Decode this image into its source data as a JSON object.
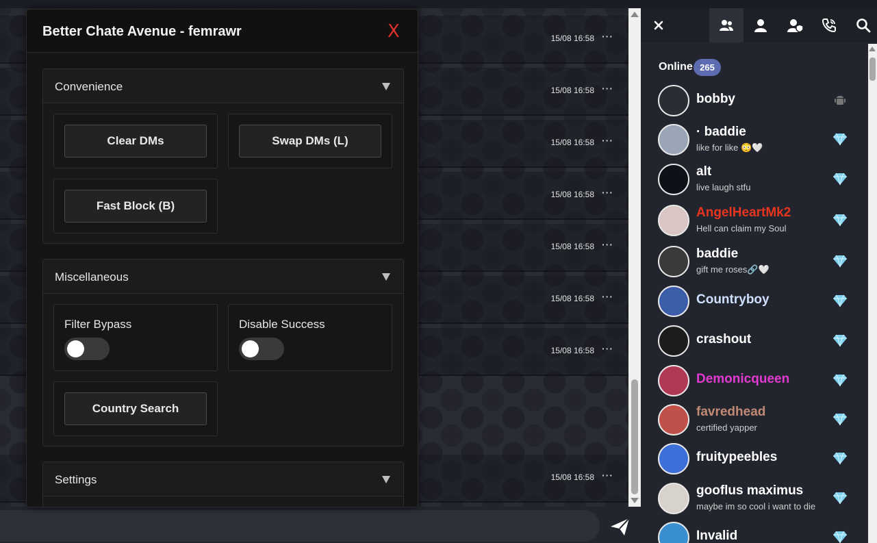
{
  "chat": {
    "messages": [
      {
        "time": "15/08 16:58",
        "more": "···"
      },
      {
        "time": "15/08 16:58",
        "more": "···"
      },
      {
        "time": "15/08 16:58",
        "more": "···"
      },
      {
        "time": "15/08 16:58",
        "more": "···"
      },
      {
        "time": "15/08 16:58",
        "more": "···"
      },
      {
        "time": "15/08 16:58",
        "more": "···"
      },
      {
        "time": "15/08 16:58",
        "more": "···"
      },
      {
        "time": "15/08 16:58",
        "more": "···"
      }
    ],
    "input_placeholder": ""
  },
  "panel": {
    "title": "Better Chate Avenue - femrawr",
    "close_label": "X",
    "sections": {
      "convenience": {
        "title": "Convenience",
        "clear_dms": "Clear DMs",
        "swap_dms": "Swap DMs (L)",
        "fast_block": "Fast Block (B)"
      },
      "misc": {
        "title": "Miscellaneous",
        "filter_bypass": "Filter Bypass",
        "filter_bypass_on": false,
        "disable_success": "Disable Success",
        "disable_success_on": false,
        "country_search": "Country Search"
      },
      "settings": {
        "title": "Settings"
      }
    }
  },
  "sidebar": {
    "close_icon": "close-icon",
    "tabs": [
      "users-icon",
      "user-icon",
      "user-shield-icon",
      "phone-icon",
      "search-icon"
    ],
    "online_label": "Online",
    "online_count": "265",
    "users": [
      {
        "name": "bobby",
        "mood": "",
        "color": "#ffffff",
        "rank": "android-icon",
        "avatar_bg": "#2b2d35"
      },
      {
        "name": "· baddie",
        "mood": "like for like 😳🤍",
        "color": "#ffffff",
        "rank": "diamond-icon",
        "avatar_bg": "#9aa6b8"
      },
      {
        "name": "alt",
        "mood": "live laugh stfu",
        "color": "#ffffff",
        "rank": "diamond-icon",
        "avatar_bg": "#0e1218"
      },
      {
        "name": "AngelHeartMk2",
        "mood": "Hell can claim my Soul",
        "color": "#e8351f",
        "rank": "diamond-icon",
        "avatar_bg": "#d9c6c4"
      },
      {
        "name": "baddie",
        "mood": "gift me roses🔗🤍",
        "color": "#ffffff",
        "rank": "diamond-icon",
        "avatar_bg": "#3a3a3a"
      },
      {
        "name": "Countryboy",
        "mood": "",
        "color": "#cfe0ff",
        "rank": "diamond-icon",
        "avatar_bg": "#3a5fa8"
      },
      {
        "name": "crashout",
        "mood": "",
        "color": "#ffffff",
        "rank": "diamond-icon",
        "avatar_bg": "#1c1c1c"
      },
      {
        "name": "Demonicqueen",
        "mood": "",
        "color": "#e23ad0",
        "rank": "diamond-icon",
        "avatar_bg": "#b03a55"
      },
      {
        "name": "favredhead",
        "mood": "certified yapper",
        "color": "#c28a74",
        "rank": "diamond-icon",
        "avatar_bg": "#c0504a"
      },
      {
        "name": "fruitypeebles",
        "mood": "",
        "color": "#ffffff",
        "rank": "diamond-icon",
        "avatar_bg": "#3c6fd8"
      },
      {
        "name": "gooflus maximus",
        "mood": "maybe im so cool i want to die",
        "color": "#ffffff",
        "rank": "diamond-icon",
        "avatar_bg": "#d8d2cc"
      },
      {
        "name": "Invalid",
        "mood": "",
        "color": "#ffffff",
        "rank": "diamond-icon",
        "avatar_bg": "#3a8fd0"
      }
    ]
  },
  "colors": {
    "accent": "#5d6bb0",
    "close_red": "#e0302e",
    "diamond": "#7fd3f0"
  }
}
